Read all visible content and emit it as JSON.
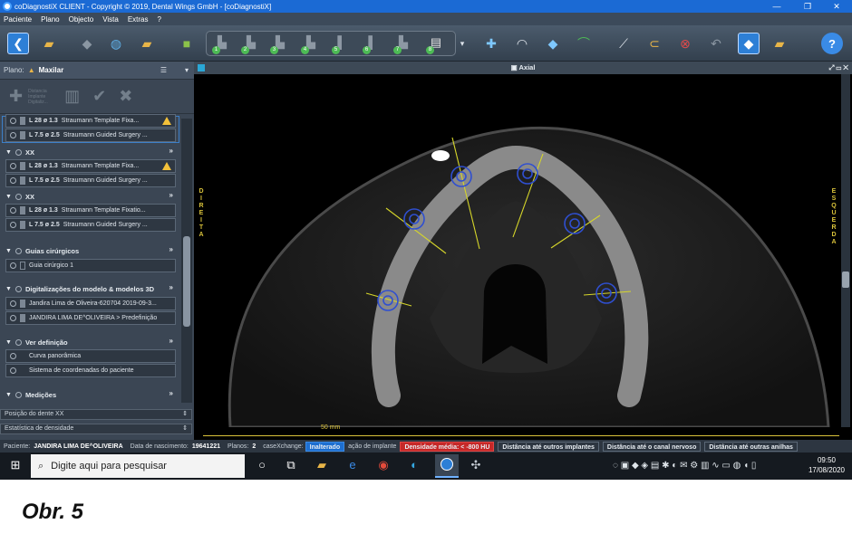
{
  "window": {
    "title": "coDiagnostiX CLIENT - Copyright © 2019, Dental Wings GmbH - [coDiagnostiX]",
    "min_glyph": "—",
    "max_glyph": "❐",
    "close_glyph": "✕"
  },
  "menu": [
    "Paciente",
    "Plano",
    "Objecto",
    "Vista",
    "Extras",
    "?"
  ],
  "toolbar": {
    "tooth_numbers": [
      "1",
      "2",
      "3",
      "4",
      "5",
      "6",
      "7",
      "8"
    ]
  },
  "panel": {
    "plano_label": "Plano:",
    "plano_value": "Maxilar",
    "tool_text": "Distancia Implante Digitaliz...",
    "implant_groups": [
      {
        "title": "",
        "rows": [
          {
            "dims": "L 28  ø 1.3",
            "name": "Straumann Template Fixa...",
            "warn": true
          },
          {
            "dims": "L 7.5  ø 2.5",
            "name": "Straumann Guided Surgery ...",
            "warn": false
          }
        ]
      },
      {
        "title": "XX",
        "rows": [
          {
            "dims": "L 28  ø 1.3",
            "name": "Straumann Template Fixa...",
            "warn": true
          },
          {
            "dims": "L 7.5  ø 2.5",
            "name": "Straumann Guided Surgery ...",
            "warn": false
          }
        ]
      },
      {
        "title": "XX",
        "rows": [
          {
            "dims": "L 28  ø 1.3",
            "name": "Straumann Template Fixatio...",
            "warn": false
          },
          {
            "dims": "L 7.5  ø 2.5",
            "name": "Straumann Guided Surgery ...",
            "warn": false
          }
        ]
      }
    ],
    "guias": {
      "title": "Guias cirúrgicos",
      "items": [
        "Guia cirúrgico 1"
      ]
    },
    "digitalizacoes": {
      "title": "Digitalizações do modelo & modelos 3D",
      "items": [
        "Jandira Lima de Oliveira-620704 2019-09-3...",
        "JANDIRA LIMA DE^OLIVEIRA > Predefinição"
      ]
    },
    "ver_definicao": {
      "title": "Ver definição",
      "items": [
        "Curva panorâmica",
        "Sistema de coordenadas do paciente"
      ]
    },
    "medicoes": {
      "title": "Medições"
    },
    "dropdowns": [
      "Posição do dente XX",
      "Estatística de densidade"
    ]
  },
  "view": {
    "title": "Axial",
    "left_label": "DIREITA",
    "right_label": "ESQUERDA",
    "scale_label": "50 mm"
  },
  "status": {
    "paciente_label": "Paciente:",
    "paciente": "JANDIRA LIMA DE^OLIVEIRA",
    "nasc_label": "Data de nascimento:",
    "nasc": "19641221",
    "planos_label": "Planos:",
    "planos": "2",
    "casex": "caseXchange:",
    "pill_blue": "Inalterado",
    "pill_blue_tail": "ação de implante",
    "pills": [
      "Densidade média: < -800 HU",
      "Distância até outros implantes",
      "Distância até o canal nervoso",
      "Distância até outras anilhas"
    ]
  },
  "taskbar": {
    "search_placeholder": "Digite aqui para pesquisar",
    "time": "09:50",
    "date": "17/08/2020"
  },
  "caption": "Obr. 5",
  "colors": {
    "accent": "#1b6ad4",
    "panel": "#3b4654",
    "implant_ring": "#2f4fd0",
    "axis_line": "#d6d62a",
    "warning": "#f3c13a",
    "density_red": "#c62828"
  }
}
